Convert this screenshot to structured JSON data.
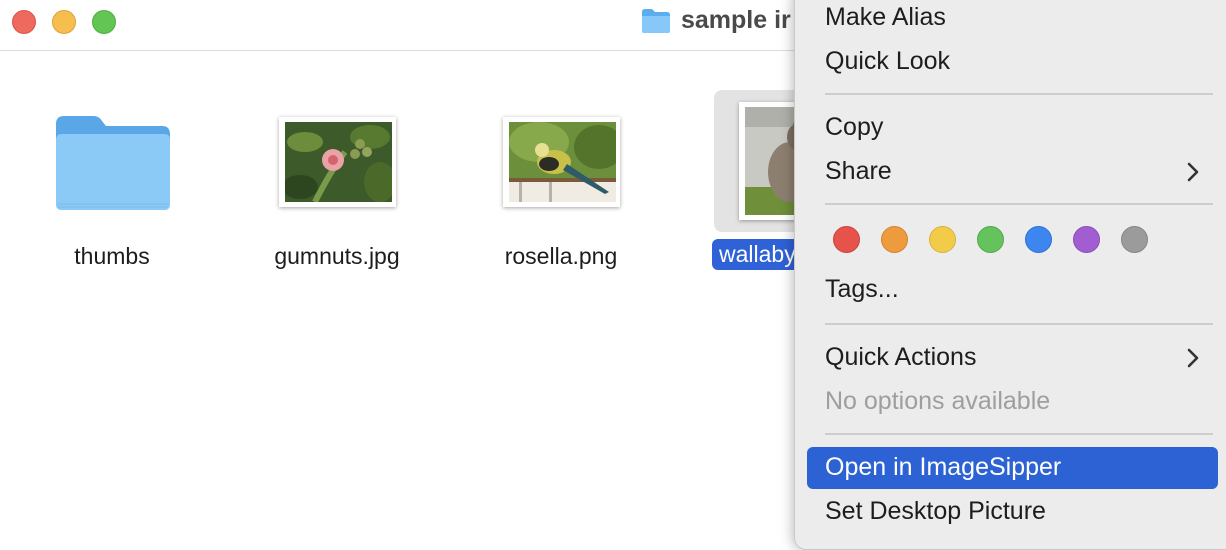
{
  "window": {
    "title": "sample ir"
  },
  "files": [
    {
      "name": "thumbs",
      "kind": "folder"
    },
    {
      "name": "gumnuts.jpg",
      "kind": "image"
    },
    {
      "name": "rosella.png",
      "kind": "image"
    },
    {
      "name": "wallaby",
      "kind": "image",
      "selected": true
    }
  ],
  "menu": {
    "make_alias": "Make Alias",
    "quick_look": "Quick Look",
    "copy": "Copy",
    "share": "Share",
    "tags": "Tags...",
    "quick_actions": "Quick Actions",
    "no_options": "No options available",
    "open_in": "Open in ImageSipper",
    "set_desktop": "Set Desktop Picture",
    "tag_colors": [
      "#e5534b",
      "#ee9b3e",
      "#f2cc48",
      "#64c35c",
      "#3d86f0",
      "#a25ed1",
      "#9b9b9b"
    ]
  }
}
